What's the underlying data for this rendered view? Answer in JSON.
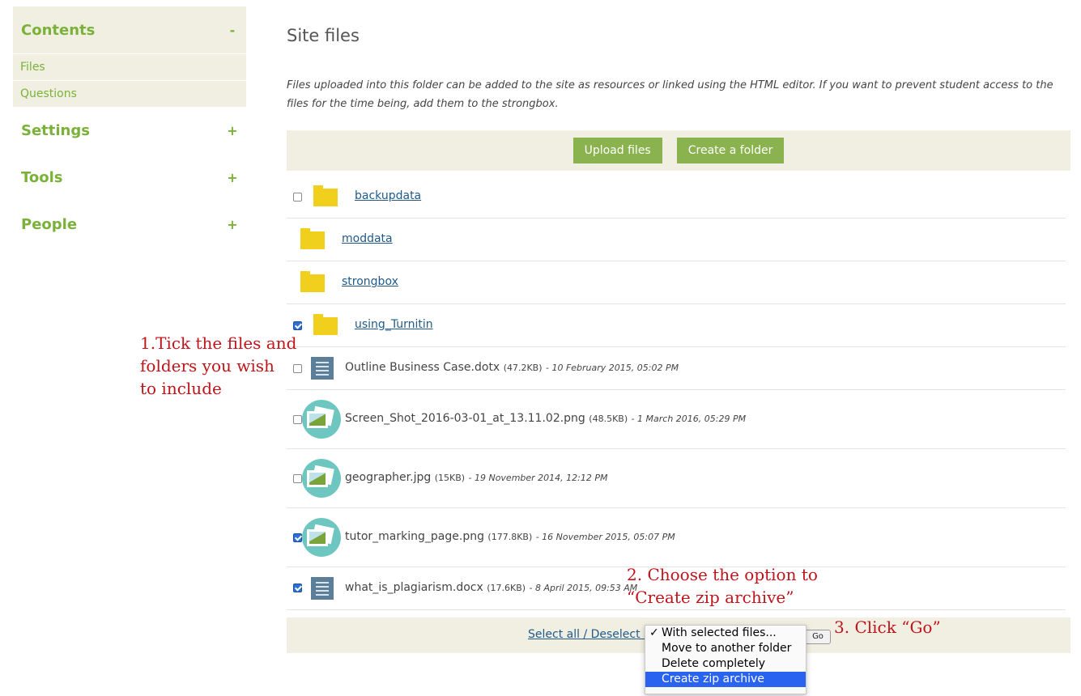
{
  "sidebar": {
    "contents": {
      "title": "Contents",
      "toggle": "-",
      "items": [
        "Files",
        "Questions"
      ]
    },
    "settings": {
      "title": "Settings",
      "toggle": "+"
    },
    "tools": {
      "title": "Tools",
      "toggle": "+"
    },
    "people": {
      "title": "People",
      "toggle": "+"
    }
  },
  "main": {
    "title": "Site files",
    "intro": "Files uploaded into this folder can be added to the site as resources or linked using the HTML editor. If you want to prevent student access to the files for the time being, add them to the strongbox.",
    "upload_label": "Upload files",
    "create_folder_label": "Create a folder"
  },
  "files": [
    {
      "name": "backupdata",
      "kind": "folder",
      "checkbox": true,
      "checked": false
    },
    {
      "name": "moddata",
      "kind": "folder",
      "checkbox": false,
      "checked": false
    },
    {
      "name": "strongbox",
      "kind": "folder",
      "checkbox": false,
      "checked": false
    },
    {
      "name": "using_Turnitin",
      "kind": "folder",
      "checkbox": true,
      "checked": true
    },
    {
      "name": "Outline Business Case.dotx",
      "kind": "document",
      "size": "(47.2KB)",
      "date": "- 10 February 2015, 05:02 PM",
      "checked": false
    },
    {
      "name": "Screen_Shot_2016-03-01_at_13.11.02.png",
      "kind": "image",
      "size": "(48.5KB)",
      "date": "- 1 March 2016, 05:29 PM",
      "checked": false
    },
    {
      "name": "geographer.jpg",
      "kind": "image",
      "size": "(15KB)",
      "date": "- 19 November 2014, 12:12 PM",
      "checked": false
    },
    {
      "name": "tutor_marking_page.png",
      "kind": "image",
      "size": "(177.8KB)",
      "date": "- 16 November 2015, 05:07 PM",
      "checked": true
    },
    {
      "name": "what_is_plagiarism.docx",
      "kind": "document",
      "size": "(17.6KB)",
      "date": "- 8 April 2015, 09:53 AM",
      "checked": true
    }
  ],
  "footer": {
    "select_all_label": "Select all / Deselect all",
    "go_label": "Go",
    "dropdown_options": [
      "With selected files...",
      "Move to another folder",
      "Delete completely",
      "Create zip archive"
    ],
    "selected_tick": "✓",
    "highlighted_option": "Create zip archive"
  },
  "annotations": {
    "step1": [
      "1.Tick the files and",
      "folders you wish",
      "to include"
    ],
    "step2": [
      "2. Choose the option to",
      "“Create zip archive”"
    ],
    "step3": "3. Click “Go”"
  },
  "colors": {
    "accent_green": "#7ab239",
    "button_green": "#8ab24e",
    "panel_beige": "#f1efe2",
    "folder_yellow": "#f1cf1d",
    "annotation_red": "#c0131a",
    "highlight_blue": "#2a63f0"
  }
}
